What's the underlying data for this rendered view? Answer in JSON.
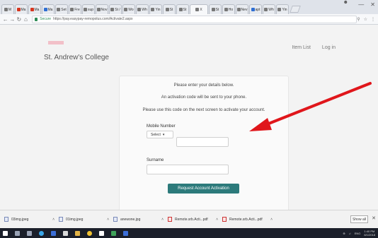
{
  "browser": {
    "tabs": [
      {
        "label": "M",
        "favicon": "gray"
      },
      {
        "label": "Ma",
        "favicon": "red"
      },
      {
        "label": "Ma",
        "favicon": "red"
      },
      {
        "label": "Ma",
        "favicon": "blue"
      },
      {
        "label": "Set",
        "favicon": "gray"
      },
      {
        "label": "Fre",
        "favicon": "gray"
      },
      {
        "label": "sup",
        "favicon": "gray"
      },
      {
        "label": "Nov",
        "favicon": "gray"
      },
      {
        "label": "St /",
        "favicon": "gray"
      },
      {
        "label": "Wo",
        "favicon": "gray"
      },
      {
        "label": "Wh",
        "favicon": "gray"
      },
      {
        "label": "Yin",
        "favicon": "gray"
      },
      {
        "label": "St",
        "favicon": "gray"
      },
      {
        "label": "St",
        "favicon": "gray"
      },
      {
        "label": "X",
        "favicon": "gray",
        "active": true
      },
      {
        "label": "St",
        "favicon": "gray"
      },
      {
        "label": "Ho",
        "favicon": "gray"
      },
      {
        "label": "Nev",
        "favicon": "gray"
      },
      {
        "label": "apt",
        "favicon": "blue"
      },
      {
        "label": "Wh",
        "favicon": "gray"
      },
      {
        "label": "Yin",
        "favicon": "gray"
      }
    ],
    "secure_label": "Secure",
    "url": "https://pay.easypay-remopolus.com/Activate2.aspx"
  },
  "site": {
    "college_name": "St. Andrew's College",
    "nav": {
      "item_list": "Item List",
      "login": "Log in"
    }
  },
  "form": {
    "intro_1": "Please enter your details below.",
    "intro_2": "An activation code will be sent to your phone.",
    "intro_3": "Please use this code on the next screen to activate your account.",
    "mobile_label": "Mobile Number",
    "select_value": "Select",
    "surname_label": "Surname",
    "submit_label": "Request Account Activation"
  },
  "downloads": [
    {
      "name": "03img.jpeg",
      "type": "image"
    },
    {
      "name": "01img.jpeg",
      "type": "image"
    },
    {
      "name": "anewone.jpg",
      "type": "image"
    },
    {
      "name": "Remote.srb.Acti...pdf",
      "type": "pdf"
    },
    {
      "name": "Remote.srb.Acti...pdf",
      "type": "pdf"
    }
  ],
  "download_bar": {
    "show_all": "Show all"
  },
  "taskbar": {
    "lang": "ENG",
    "time": "1:40 PM",
    "date": "8/1/2018"
  },
  "colors": {
    "accent_button": "#2c7a7b",
    "annotation_arrow": "#e0161b"
  }
}
